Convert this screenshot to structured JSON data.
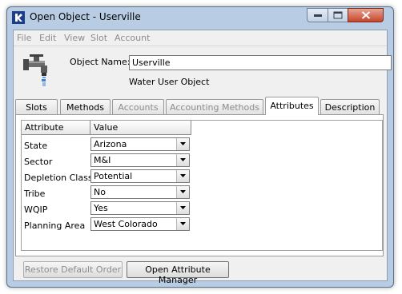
{
  "window": {
    "title": "Open Object - Userville",
    "icon": "riverware-logo-icon",
    "controls": [
      "minimize-icon",
      "maximize-icon",
      "close-icon"
    ]
  },
  "menu": {
    "items": [
      "File",
      "Edit",
      "View",
      "Slot",
      "Account"
    ]
  },
  "object": {
    "name_label": "Object Name:",
    "name_value": "Userville",
    "type_label": "Water User Object",
    "icon": "faucet-icon"
  },
  "tabs": [
    {
      "label": "Slots",
      "enabled": true
    },
    {
      "label": "Methods",
      "enabled": true
    },
    {
      "label": "Accounts",
      "enabled": false
    },
    {
      "label": "Accounting Methods",
      "enabled": false
    },
    {
      "label": "Attributes",
      "enabled": true,
      "active": true
    },
    {
      "label": "Description",
      "enabled": true
    }
  ],
  "attributes": {
    "headers": [
      "Attribute",
      "Value"
    ],
    "rows": [
      {
        "name": "State",
        "value": "Arizona"
      },
      {
        "name": "Sector",
        "value": "M&I"
      },
      {
        "name": "Depletion Class",
        "value": "Potential"
      },
      {
        "name": "Tribe",
        "value": "No"
      },
      {
        "name": "WQIP",
        "value": "Yes"
      },
      {
        "name": "Planning Area",
        "value": "West Colorado"
      }
    ]
  },
  "buttons": {
    "restore_default_order": "Restore Default Order",
    "open_attribute_manager": "Open Attribute Manager"
  }
}
